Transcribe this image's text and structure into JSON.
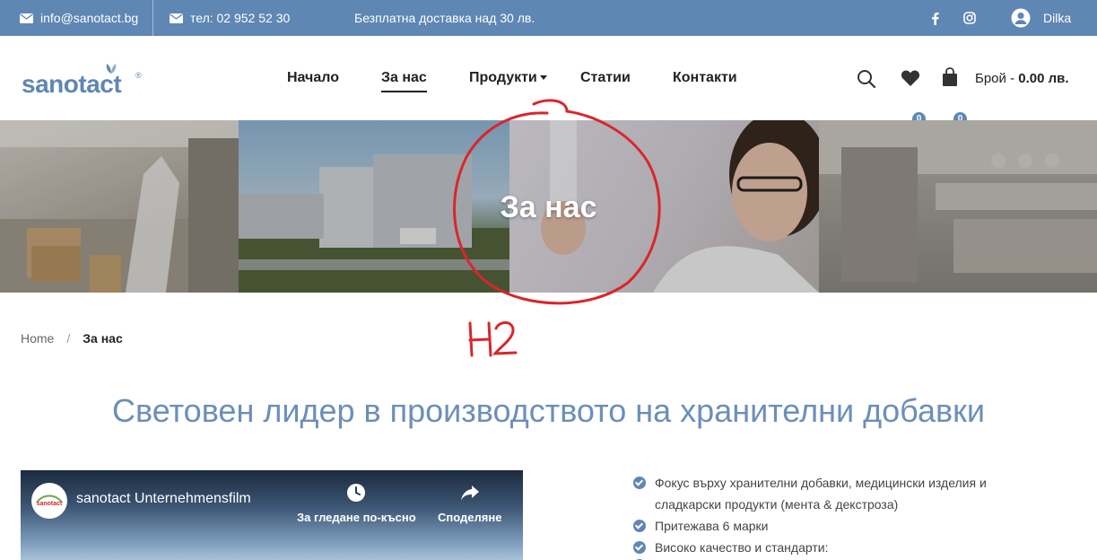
{
  "topbar": {
    "email": "info@sanotact.bg",
    "phone": "тел: 02 952 52 30",
    "promo": "Безплатна доставка над 30 лв.",
    "user_name": "Dilka",
    "icons": [
      "envelope-icon",
      "envelope-icon",
      "facebook-icon",
      "instagram-icon",
      "user-icon"
    ]
  },
  "header": {
    "logo_text": "sanotact",
    "logo_reg": "®",
    "nav": [
      {
        "label": "Начало"
      },
      {
        "label": "За нас"
      },
      {
        "label": "Продукти"
      },
      {
        "label": "Статии"
      },
      {
        "label": "Контакти"
      }
    ],
    "active_nav": "За нас",
    "wishlist_count": "0",
    "cart_count": "0",
    "cart_label": "Брой - ",
    "cart_total": "0.00 лв."
  },
  "hero": {
    "title": "За нас"
  },
  "annotation": {
    "text": "H2",
    "color": "#d9262b"
  },
  "breadcrumb": {
    "home": "Home",
    "separator": "/",
    "current": "За нас"
  },
  "main": {
    "heading": "Световен лидер в производството на хранителни добавки"
  },
  "video": {
    "title": "sanotact Unternehmensfilm",
    "watch_later": "За гледане по-късно",
    "share": "Споделяне"
  },
  "features": [
    "Фокус върху хранителни добавки, медицински изделия и сладкарски продукти (мента & декстроза)",
    "Притежава 6 марки",
    "Високо качество и стандарти:"
  ],
  "colors": {
    "brand": "#5f87b4",
    "heading": "#6b8fba",
    "annotation": "#d9262b"
  }
}
